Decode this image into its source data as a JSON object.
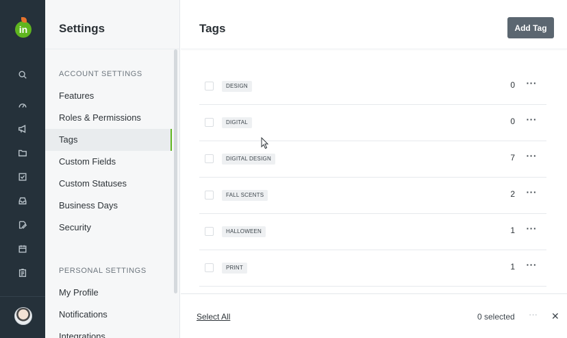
{
  "rail": {
    "logo_text": "in",
    "icons": [
      "search-icon",
      "dashboard-icon",
      "megaphone-icon",
      "folder-icon",
      "checkbox-icon",
      "inbox-icon",
      "file-edit-icon",
      "calendar-icon",
      "report-icon"
    ]
  },
  "sidebar": {
    "title": "Settings",
    "account_section": "ACCOUNT SETTINGS",
    "account_items": [
      "Features",
      "Roles & Permissions",
      "Tags",
      "Custom Fields",
      "Custom Statuses",
      "Business Days",
      "Security"
    ],
    "active_item": "Tags",
    "personal_section": "PERSONAL SETTINGS",
    "personal_items": [
      "My Profile",
      "Notifications",
      "Integrations"
    ]
  },
  "main": {
    "title": "Tags",
    "add_button": "Add Tag",
    "tags": [
      {
        "name": "DESIGN",
        "count": "0"
      },
      {
        "name": "DIGITAL",
        "count": "0"
      },
      {
        "name": "DIGITAL DESIGN",
        "count": "7"
      },
      {
        "name": "FALL SCENTS",
        "count": "2"
      },
      {
        "name": "HALLOWEEN",
        "count": "1"
      },
      {
        "name": "PRINT",
        "count": "1"
      }
    ],
    "more_glyph": "···"
  },
  "footer": {
    "select_all": "Select All",
    "selected_count": "0 selected",
    "more_glyph": "···",
    "close_glyph": "✕"
  },
  "colors": {
    "rail_bg": "#25313a",
    "accent_green": "#5fb51f",
    "logo_leaf": "#e8732c",
    "button_bg": "#5b6670"
  }
}
